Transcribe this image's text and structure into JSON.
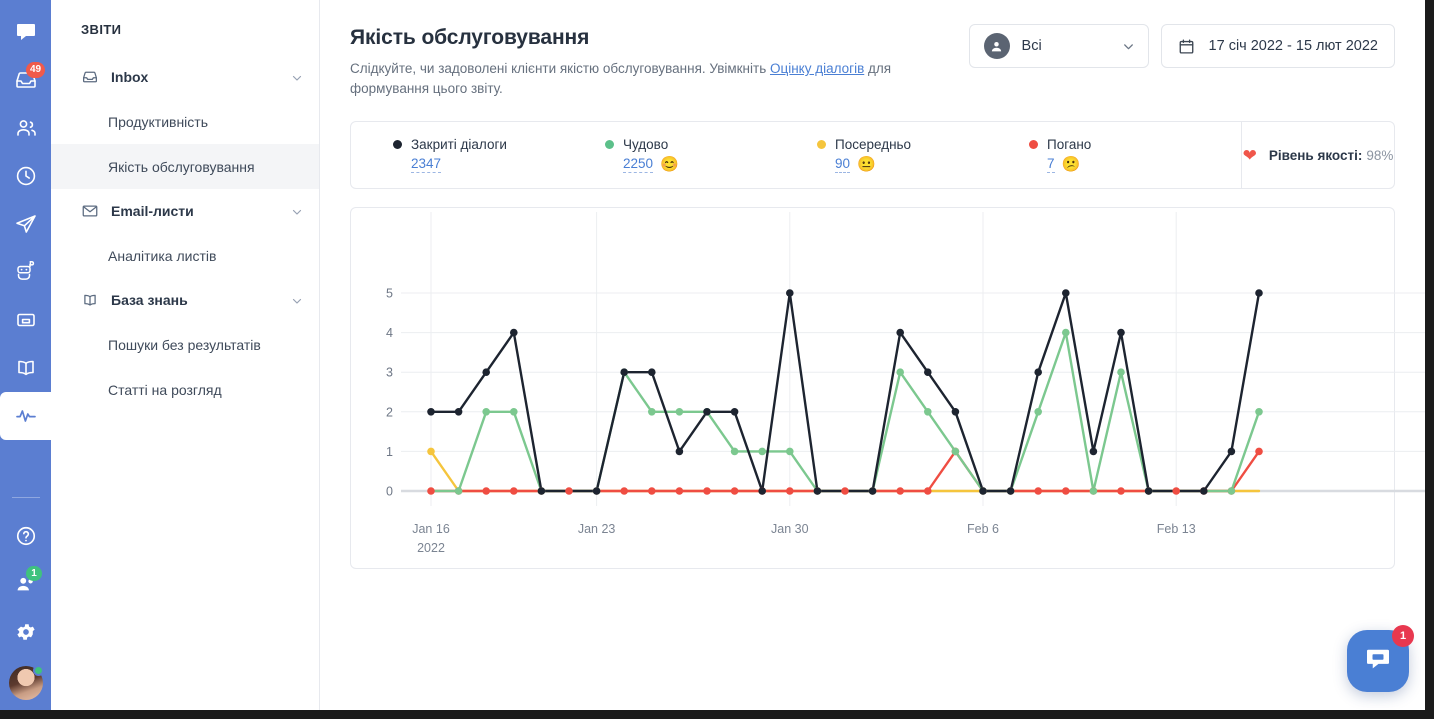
{
  "rail": {
    "items": [
      {
        "name": "chats-icon",
        "badge": null
      },
      {
        "name": "inbox-icon",
        "badge": "49"
      },
      {
        "name": "contacts-icon",
        "badge": null
      },
      {
        "name": "history-icon",
        "badge": null
      },
      {
        "name": "send-icon",
        "badge": null
      },
      {
        "name": "bot-icon",
        "badge": null
      },
      {
        "name": "archive-icon",
        "badge": null
      },
      {
        "name": "knowledge-base-icon",
        "badge": null
      },
      {
        "name": "reports-icon",
        "badge": null
      }
    ],
    "bottom": [
      {
        "name": "help-icon",
        "badge": null
      },
      {
        "name": "team-icon",
        "badge": "1"
      },
      {
        "name": "settings-icon",
        "badge": null
      }
    ]
  },
  "sidebar": {
    "title": "ЗВІТИ",
    "entries": [
      {
        "type": "group",
        "label": "Inbox",
        "icon": "inbox-icon"
      },
      {
        "type": "item",
        "label": "Продуктивність",
        "active": false
      },
      {
        "type": "item",
        "label": "Якість обслуговування",
        "active": true
      },
      {
        "type": "group",
        "label": "Email-листи",
        "icon": "mail-icon"
      },
      {
        "type": "item",
        "label": "Аналітика листів",
        "active": false
      },
      {
        "type": "group",
        "label": "База знань",
        "icon": "book-icon"
      },
      {
        "type": "item",
        "label": "Пошуки без результатів",
        "active": false
      },
      {
        "type": "item",
        "label": "Статті на розгляд",
        "active": false
      }
    ]
  },
  "header": {
    "title": "Якість обслуговування",
    "subtitle_before": "Слідкуйте, чи задоволені клієнти якістю обслуговування. Увімкніть ",
    "subtitle_link": "Оцінку діалогів",
    "subtitle_after": " для формування цього звіту.",
    "agent_filter": "Всі",
    "date_range": "17 січ 2022 - 15 лют 2022"
  },
  "summary": {
    "items": [
      {
        "label": "Закриті діалоги",
        "value": "2347",
        "color": "#1d2430",
        "emoji": ""
      },
      {
        "label": "Чудово",
        "value": "2250",
        "color": "#5cc08a",
        "emoji": "😊"
      },
      {
        "label": "Посередньо",
        "value": "90",
        "color": "#f5c53d",
        "emoji": "😐"
      },
      {
        "label": "Погано",
        "value": "7",
        "color": "#ef4d42",
        "emoji": "😕"
      }
    ],
    "quality_label": "Рівень якості:",
    "quality_value": "98%"
  },
  "chat_widget": {
    "badge": "1"
  },
  "chart_data": {
    "type": "line",
    "title": "",
    "xlabel": "",
    "ylabel": "",
    "ylim": [
      0,
      5
    ],
    "yticks": [
      0,
      1,
      2,
      3,
      4,
      5
    ],
    "grid": true,
    "legend": "top-external",
    "x_tick_labels": [
      {
        "index": 0,
        "label": "Jan 16",
        "label2": "2022"
      },
      {
        "index": 6,
        "label": "Jan 23",
        "label2": ""
      },
      {
        "index": 13,
        "label": "Jan 30",
        "label2": ""
      },
      {
        "index": 20,
        "label": "Feb 6",
        "label2": ""
      },
      {
        "index": 27,
        "label": "Feb 13",
        "label2": ""
      }
    ],
    "x": [
      "Jan 16",
      "Jan 17",
      "Jan 18",
      "Jan 19",
      "Jan 20",
      "Jan 21",
      "Jan 22",
      "Jan 23",
      "Jan 24",
      "Jan 25",
      "Jan 26",
      "Jan 27",
      "Jan 28",
      "Jan 29",
      "Jan 30",
      "Jan 31",
      "Feb 1",
      "Feb 2",
      "Feb 3",
      "Feb 4",
      "Feb 5",
      "Feb 6",
      "Feb 7",
      "Feb 8",
      "Feb 9",
      "Feb 10",
      "Feb 11",
      "Feb 12",
      "Feb 13",
      "Feb 14",
      "Feb 15"
    ],
    "series": [
      {
        "name": "Закриті діалоги",
        "color": "#1d2430",
        "values": [
          2,
          2,
          3,
          4,
          0,
          0,
          0,
          3,
          3,
          1,
          2,
          2,
          0,
          5,
          0,
          0,
          0,
          4,
          3,
          2,
          0,
          0,
          3,
          5,
          1,
          4,
          0,
          0,
          0,
          1,
          5
        ]
      },
      {
        "name": "Чудово",
        "color": "#7cc88f",
        "values": [
          0,
          0,
          2,
          2,
          0,
          0,
          0,
          3,
          2,
          2,
          2,
          1,
          1,
          1,
          0,
          0,
          0,
          3,
          2,
          1,
          0,
          0,
          2,
          4,
          0,
          3,
          0,
          0,
          0,
          0,
          2
        ]
      },
      {
        "name": "Посередньо",
        "color": "#f5c53d",
        "values": [
          1,
          0,
          0,
          0,
          0,
          0,
          0,
          0,
          0,
          0,
          0,
          0,
          0,
          0,
          0,
          0,
          0,
          0,
          0,
          0,
          0,
          0,
          0,
          0,
          0,
          0,
          0,
          0,
          0,
          0,
          0
        ]
      },
      {
        "name": "Погано",
        "color": "#ef4d42",
        "values": [
          0,
          0,
          0,
          0,
          0,
          0,
          0,
          0,
          0,
          0,
          0,
          0,
          0,
          0,
          0,
          0,
          0,
          0,
          0,
          1,
          0,
          0,
          0,
          0,
          0,
          0,
          0,
          0,
          0,
          0,
          1
        ]
      }
    ]
  }
}
